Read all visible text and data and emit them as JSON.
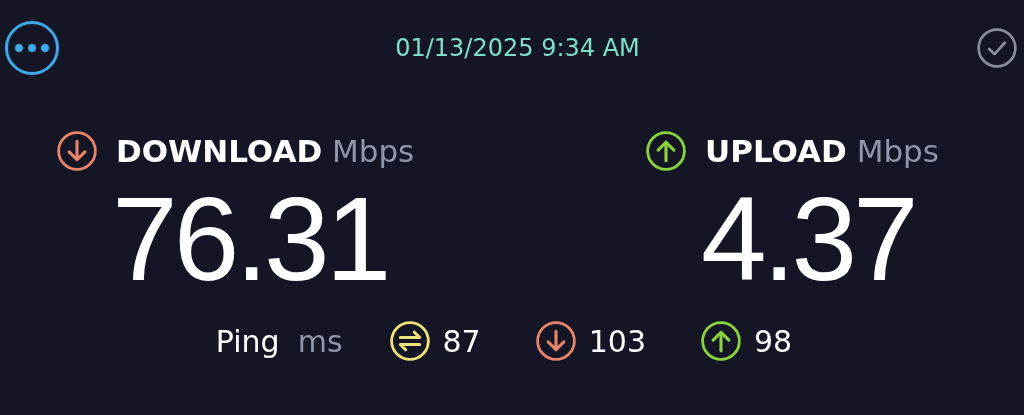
{
  "header": {
    "datetime": "01/13/2025 9:34 AM"
  },
  "results": [
    {
      "kind": "download",
      "label": "DOWNLOAD",
      "unit": "Mbps",
      "value": "76.31",
      "color": "#e8846a"
    },
    {
      "kind": "upload",
      "label": "UPLOAD",
      "unit": "Mbps",
      "value": "4.37",
      "color": "#8ad33e"
    }
  ],
  "ping": {
    "label": "Ping",
    "unit": "ms",
    "readings": [
      {
        "kind": "idle",
        "value": "87",
        "color": "#efe27a"
      },
      {
        "kind": "download",
        "value": "103",
        "color": "#e8846a"
      },
      {
        "kind": "upload",
        "value": "98",
        "color": "#8ad33e"
      }
    ]
  }
}
